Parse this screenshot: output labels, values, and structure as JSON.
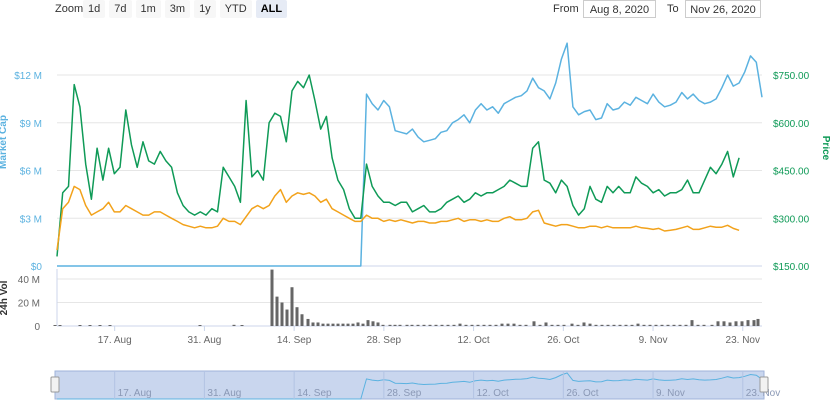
{
  "toolbar": {
    "zoom_label": "Zoom",
    "zoom_buttons": [
      "1d",
      "7d",
      "1m",
      "3m",
      "1y",
      "YTD",
      "ALL"
    ],
    "active_button": "ALL",
    "from_label": "From",
    "from_value": "Aug 8, 2020",
    "to_label": "To",
    "to_value": "Nov 26, 2020"
  },
  "colors": {
    "market_cap": "#5bb2e0",
    "price": "#0f9a57",
    "orange": "#f2a21b",
    "volume": "#666666"
  },
  "chart_data": {
    "type": "line",
    "x_start": "2020-08-08",
    "x_end": "2020-11-26",
    "x_ticks": [
      "17. Aug",
      "31. Aug",
      "14. Sep",
      "28. Sep",
      "12. Oct",
      "26. Oct",
      "9. Nov",
      "23. Nov"
    ],
    "x_tick_dates": [
      "2020-08-17",
      "2020-08-31",
      "2020-09-14",
      "2020-09-28",
      "2020-10-12",
      "2020-10-26",
      "2020-11-09",
      "2020-11-23"
    ],
    "ylabel_left": "Market Cap",
    "ylabel_right": "Price",
    "ylabel_volume": "24h Vol",
    "left_ticks": [
      "$0",
      "$3 M",
      "$6 M",
      "$9 M",
      "$12 M"
    ],
    "left_tick_values": [
      0,
      3,
      6,
      9,
      12
    ],
    "right_ticks": [
      "$150.00",
      "$300.00",
      "$450.00",
      "$600.00",
      "$750.00"
    ],
    "right_tick_values": [
      150,
      300,
      450,
      600,
      750
    ],
    "volume_ticks": [
      "0",
      "20 M",
      "40 M"
    ],
    "volume_tick_values": [
      0,
      20,
      40
    ],
    "ylim_left": [
      0,
      12
    ],
    "ylim_right": [
      150,
      750
    ],
    "ylim_volume": [
      0,
      40
    ],
    "series": [
      {
        "name": "Market Cap",
        "axis": "left",
        "values": [
          0,
          0,
          0,
          0,
          0,
          0,
          0,
          0,
          0,
          0,
          0,
          0,
          0,
          0,
          0,
          0,
          0,
          0,
          0,
          0,
          0,
          0,
          0,
          0,
          0,
          0,
          0,
          0,
          0,
          0,
          0,
          0,
          0,
          0,
          0,
          0,
          0,
          0,
          0,
          0,
          0,
          0,
          0,
          0,
          0,
          0,
          0,
          0,
          0,
          0,
          0,
          0,
          0,
          0,
          10.8,
          10.2,
          9.8,
          10.4,
          10.0,
          8.5,
          8.4,
          8.3,
          8.6,
          8.1,
          7.8,
          7.9,
          8.0,
          8.4,
          8.5,
          9.0,
          9.2,
          9.5,
          9.0,
          9.8,
          10.2,
          9.8,
          10.0,
          9.6,
          10.2,
          10.4,
          10.6,
          10.7,
          11.0,
          11.8,
          11.2,
          11.0,
          10.5,
          11.5,
          13.0,
          14.0,
          10.0,
          9.5,
          9.7,
          9.8,
          9.2,
          9.3,
          10.2,
          9.8,
          9.9,
          10.3,
          10.1,
          10.6,
          10.4,
          10.2,
          10.8,
          10.3,
          10.0,
          10.1,
          10.3,
          10.9,
          10.5,
          10.8,
          10.4,
          10.2,
          10.3,
          10.5,
          11.2,
          12.0,
          11.3,
          11.5,
          12.2,
          13.2,
          12.8,
          10.6
        ]
      },
      {
        "name": "Price",
        "axis": "right",
        "values": [
          180,
          380,
          400,
          720,
          650,
          470,
          360,
          520,
          420,
          520,
          440,
          460,
          640,
          530,
          460,
          540,
          480,
          470,
          510,
          480,
          460,
          380,
          340,
          320,
          310,
          320,
          310,
          330,
          320,
          460,
          430,
          400,
          350,
          670,
          430,
          450,
          420,
          600,
          630,
          620,
          540,
          700,
          730,
          710,
          750,
          670,
          580,
          620,
          490,
          420,
          390,
          330,
          300,
          300,
          470,
          400,
          370,
          350,
          350,
          340,
          350,
          350,
          320,
          330,
          340,
          320,
          320,
          330,
          350,
          360,
          370,
          350,
          360,
          380,
          370,
          380,
          380,
          390,
          400,
          420,
          410,
          400,
          400,
          520,
          540,
          420,
          410,
          380,
          420,
          400,
          340,
          310,
          330,
          400,
          360,
          350,
          400,
          380,
          400,
          380,
          380,
          430,
          410,
          400,
          380,
          390,
          370,
          380,
          380,
          390,
          420,
          380,
          380,
          420,
          460,
          440,
          470,
          510,
          430,
          490
        ]
      },
      {
        "name": "Orange",
        "axis": "right",
        "values": [
          200,
          330,
          350,
          400,
          390,
          340,
          310,
          320,
          330,
          350,
          320,
          320,
          340,
          330,
          320,
          310,
          310,
          320,
          320,
          310,
          300,
          290,
          280,
          275,
          270,
          275,
          270,
          270,
          275,
          300,
          290,
          290,
          280,
          305,
          330,
          340,
          330,
          340,
          370,
          390,
          350,
          370,
          380,
          375,
          380,
          370,
          350,
          360,
          330,
          320,
          310,
          300,
          290,
          290,
          310,
          300,
          300,
          290,
          295,
          290,
          295,
          290,
          285,
          290,
          290,
          285,
          285,
          290,
          290,
          295,
          300,
          290,
          295,
          295,
          290,
          295,
          290,
          290,
          300,
          305,
          295,
          295,
          300,
          320,
          325,
          285,
          280,
          275,
          280,
          280,
          275,
          270,
          270,
          275,
          275,
          270,
          275,
          270,
          270,
          270,
          270,
          275,
          270,
          268,
          265,
          268,
          260,
          262,
          265,
          270,
          275,
          265,
          265,
          270,
          275,
          272,
          272,
          278,
          268,
          262
        ]
      }
    ],
    "volume": [
      0,
      0,
      0,
      0,
      0,
      0,
      0,
      0,
      0,
      0,
      0,
      0,
      0,
      0,
      0,
      0,
      0,
      0,
      0,
      0,
      0,
      0,
      0,
      0,
      0,
      0,
      0,
      0,
      0,
      0,
      0,
      0,
      0,
      0,
      0,
      0,
      0,
      0,
      0,
      0,
      0,
      0,
      0,
      0,
      0,
      0,
      0,
      0,
      0,
      0,
      0,
      0,
      0,
      0,
      0,
      0,
      0,
      0,
      0,
      0,
      0,
      0,
      0,
      0,
      0,
      0,
      0,
      0,
      0,
      0,
      0,
      0,
      0,
      0,
      0,
      0,
      0,
      0,
      0,
      0,
      0,
      0,
      0,
      0,
      0,
      0,
      0,
      0,
      0,
      0,
      0,
      0,
      0,
      0,
      0,
      0,
      0,
      0,
      0,
      0,
      0,
      0,
      0,
      0,
      0,
      0,
      0,
      0,
      0,
      0,
      0,
      0,
      0,
      0,
      0,
      0,
      0,
      0,
      0,
      0
    ],
    "volume_bars": [
      [
        55,
        0.5
      ],
      [
        60,
        0.5
      ],
      [
        80,
        0.5
      ],
      [
        90,
        0.5
      ],
      [
        100,
        0.5
      ],
      [
        110,
        0.5
      ],
      [
        200,
        0.5
      ],
      [
        234,
        1
      ],
      [
        242,
        0.5
      ],
      [
        272,
        48
      ],
      [
        277,
        25
      ],
      [
        282,
        20
      ],
      [
        287,
        14
      ],
      [
        292,
        33
      ],
      [
        297,
        16
      ],
      [
        302,
        10
      ],
      [
        308,
        6
      ],
      [
        313,
        3
      ],
      [
        318,
        3
      ],
      [
        323,
        2
      ],
      [
        328,
        2
      ],
      [
        333,
        2
      ],
      [
        338,
        2
      ],
      [
        343,
        2
      ],
      [
        348,
        2
      ],
      [
        353,
        2
      ],
      [
        358,
        3
      ],
      [
        363,
        2
      ],
      [
        368,
        5
      ],
      [
        373,
        4
      ],
      [
        378,
        3
      ],
      [
        383,
        1
      ],
      [
        390,
        1
      ],
      [
        395,
        1
      ],
      [
        400,
        1
      ],
      [
        407,
        1
      ],
      [
        412,
        1
      ],
      [
        418,
        1
      ],
      [
        424,
        1
      ],
      [
        430,
        1
      ],
      [
        436,
        1
      ],
      [
        442,
        1
      ],
      [
        448,
        1
      ],
      [
        454,
        1
      ],
      [
        460,
        2
      ],
      [
        466,
        1
      ],
      [
        472,
        1
      ],
      [
        478,
        1
      ],
      [
        484,
        1
      ],
      [
        490,
        1
      ],
      [
        496,
        1
      ],
      [
        502,
        2
      ],
      [
        508,
        2
      ],
      [
        514,
        2
      ],
      [
        520,
        1
      ],
      [
        526,
        1
      ],
      [
        534,
        4
      ],
      [
        540,
        1
      ],
      [
        546,
        3
      ],
      [
        552,
        1
      ],
      [
        558,
        1
      ],
      [
        564,
        1
      ],
      [
        572,
        2
      ],
      [
        578,
        1
      ],
      [
        584,
        3
      ],
      [
        590,
        2
      ],
      [
        596,
        1
      ],
      [
        602,
        1
      ],
      [
        608,
        1
      ],
      [
        614,
        1
      ],
      [
        620,
        1
      ],
      [
        626,
        1
      ],
      [
        632,
        1
      ],
      [
        638,
        2
      ],
      [
        644,
        1
      ],
      [
        650,
        1
      ],
      [
        656,
        1
      ],
      [
        662,
        1
      ],
      [
        668,
        1
      ],
      [
        674,
        1
      ],
      [
        680,
        1
      ],
      [
        686,
        1
      ],
      [
        692,
        5
      ],
      [
        698,
        1
      ],
      [
        704,
        1
      ],
      [
        712,
        1
      ],
      [
        718,
        4
      ],
      [
        724,
        4
      ],
      [
        730,
        3
      ],
      [
        736,
        4
      ],
      [
        742,
        4
      ],
      [
        748,
        5
      ],
      [
        754,
        5
      ],
      [
        758,
        6
      ]
    ],
    "legend": "none",
    "grid": "horizontal"
  }
}
